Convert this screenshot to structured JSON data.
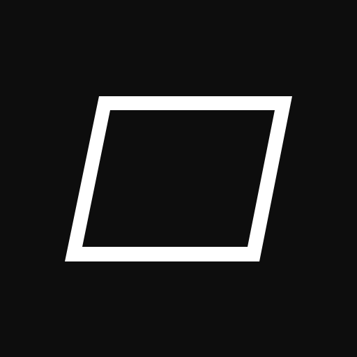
{
  "colors": {
    "background": "#0d0d0d",
    "shape": "#ffffff"
  },
  "icon": {
    "name": "parallelogram-outline-icon"
  }
}
